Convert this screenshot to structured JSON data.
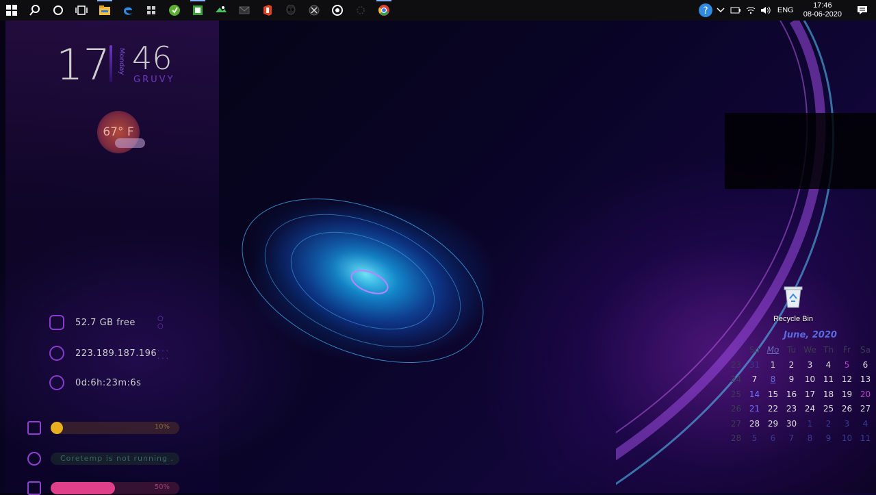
{
  "taskbar": {
    "apps": [
      {
        "name": "start-icon",
        "running": false
      },
      {
        "name": "search-icon",
        "running": false
      },
      {
        "name": "cortana-icon",
        "running": false
      },
      {
        "name": "task-view-icon",
        "running": false
      },
      {
        "name": "file-explorer-icon",
        "running": true
      },
      {
        "name": "edge-icon",
        "running": false
      },
      {
        "name": "store-icon",
        "running": false
      },
      {
        "name": "green-app-icon",
        "running": false
      },
      {
        "name": "notepad-icon",
        "running": true
      },
      {
        "name": "photos-icon",
        "running": false
      },
      {
        "name": "mail-icon",
        "running": false
      },
      {
        "name": "office-icon",
        "running": false
      },
      {
        "name": "alien-icon",
        "running": false
      },
      {
        "name": "xbox-icon",
        "running": false
      },
      {
        "name": "media-icon",
        "running": false
      },
      {
        "name": "settings-icon",
        "running": false
      },
      {
        "name": "chrome-icon",
        "running": true
      }
    ],
    "tray": {
      "language": "ENG",
      "time": "17:46",
      "date": "08-06-2020"
    }
  },
  "widgets": {
    "hour": "17",
    "minute": "46",
    "day": "Monday",
    "brand": "GRUVY",
    "weather": "67° F",
    "disk": "52.7 GB free",
    "ip": "223.189.187.196",
    "uptime": "0d:6h:23m:6s",
    "cpu_label": "10%",
    "cpu_value": 0.1,
    "coretemp_msg": "Coretemp is not running . . .",
    "ram_label": "50%",
    "ram_value": 0.5
  },
  "desktop": {
    "recycle_bin": "Recycle Bin"
  },
  "calendar": {
    "title": "June, 2020",
    "headers": [
      "Su",
      "Mo",
      "Tu",
      "We",
      "Th",
      "Fr",
      "Sa"
    ],
    "weeks": [
      {
        "week": "23",
        "days": [
          "31",
          "1",
          "2",
          "3",
          "4",
          "5",
          "6"
        ]
      },
      {
        "week": "24",
        "days": [
          "7",
          "8",
          "9",
          "10",
          "11",
          "12",
          "13"
        ]
      },
      {
        "week": "25",
        "days": [
          "14",
          "15",
          "16",
          "17",
          "18",
          "19",
          "20"
        ]
      },
      {
        "week": "26",
        "days": [
          "21",
          "22",
          "23",
          "24",
          "25",
          "26",
          "27"
        ]
      },
      {
        "week": "27",
        "days": [
          "28",
          "29",
          "30",
          "1",
          "2",
          "3",
          "4"
        ]
      },
      {
        "week": "28",
        "days": [
          "5",
          "6",
          "7",
          "8",
          "9",
          "10",
          "11"
        ]
      }
    ],
    "today": "8",
    "colors": {
      "accent": "#5a6adf",
      "holiday": "#c040d0",
      "sunday": "#7070ff"
    }
  }
}
